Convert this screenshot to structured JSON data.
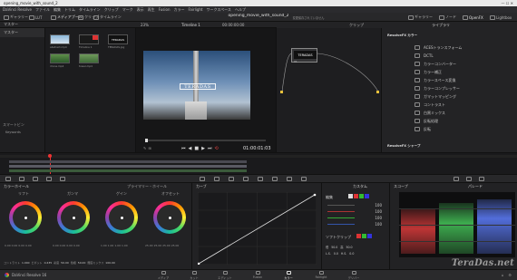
{
  "window": {
    "title": "opening_movie_with_sound_2"
  },
  "menu": [
    "DaVinci Resolve",
    "ファイル",
    "編集",
    "トリム",
    "タイムライン",
    "クリップ",
    "マーク",
    "表示",
    "再生",
    "Fusion",
    "カラー",
    "Fairlight",
    "ワークスペース",
    "ヘルプ"
  ],
  "toolbar": {
    "left": [
      "ギャラリー",
      "LUT",
      "メディアプール",
      "クリップ",
      "タイムライン"
    ],
    "project_title": "opening_movie_with_sound_2",
    "project_sub": "変更保存されていません",
    "right": [
      "ノード",
      "OpenFX",
      "Lightbox"
    ],
    "right_left": [
      "ライトボックス",
      "ギャラリー"
    ]
  },
  "media": {
    "header_tab": "マスター",
    "master_label": "マスター",
    "smart_bins": "スマートビン",
    "keywords": "Keywords",
    "clips": [
      "abstract.mp4",
      "Timeline 1",
      "TERADAS.jpg",
      "drone.mp4",
      "tower.mp4"
    ]
  },
  "viewer": {
    "zoom": "23%",
    "timeline_name": "Timeline 1",
    "timecode_top": "00:00:00:00",
    "clip_label": "TERADAS",
    "timecode": "01:00:01:03"
  },
  "nodes": {
    "header": "クリップ",
    "node_label": "01",
    "node_logo": "TERADAS"
  },
  "library": {
    "tab": "ライブラリ",
    "section_title": "ResolveFX カラー",
    "items": [
      "ACESトランスフォーム",
      "DCTL",
      "カラーコンバーター",
      "カラー補正",
      "カラースペース変換",
      "カラーコンプレッサー",
      "ガマットマッピング",
      "コントラスト",
      "白黒ミックス",
      "反転処理",
      "反転"
    ],
    "footer_title": "ResolveFX シャープ"
  },
  "palette": {
    "wheels_header": "カラーホイール",
    "mode": "プライマリー・ホイール",
    "curves_header": "カーブ",
    "custom_header": "カスタム",
    "scopes_header": "スコープ",
    "scope_mode": "パレード"
  },
  "wheels": [
    {
      "name": "リフト",
      "vals": [
        "0.00",
        "0.00",
        "0.00",
        "0.00"
      ]
    },
    {
      "name": "ガンマ",
      "vals": [
        "0.00",
        "0.00",
        "0.00",
        "0.00"
      ]
    },
    {
      "name": "ゲイン",
      "vals": [
        "1.00",
        "1.00",
        "1.00",
        "1.00"
      ]
    },
    {
      "name": "オフセット",
      "vals": [
        "25.00",
        "25.00",
        "25.00",
        "25.00"
      ]
    }
  ],
  "adjust_row": [
    "コントラスト",
    "1.000",
    "ピボット",
    "0.435",
    "彩度",
    "50.00",
    "色相",
    "50.00",
    "輝度ミックス",
    "100.00"
  ],
  "custom": {
    "edit_label": "編集",
    "rows": [
      "100",
      "100",
      "100",
      "100"
    ],
    "soft_label": "ソフトクリップ",
    "low": "低",
    "high": "高",
    "low_val": "50.0",
    "high_val": "50.0",
    "ls": "L.S.",
    "hs": "H.S.",
    "ls_val": "0.0",
    "hs_val": "0.0"
  },
  "bottom": {
    "app": "DaVinci Resolve 16",
    "tabs": [
      "メディア",
      "カット",
      "エディット",
      "Fusion",
      "カラー",
      "Fairlight",
      "デリバー"
    ]
  },
  "watermark": "TeraDas.net"
}
